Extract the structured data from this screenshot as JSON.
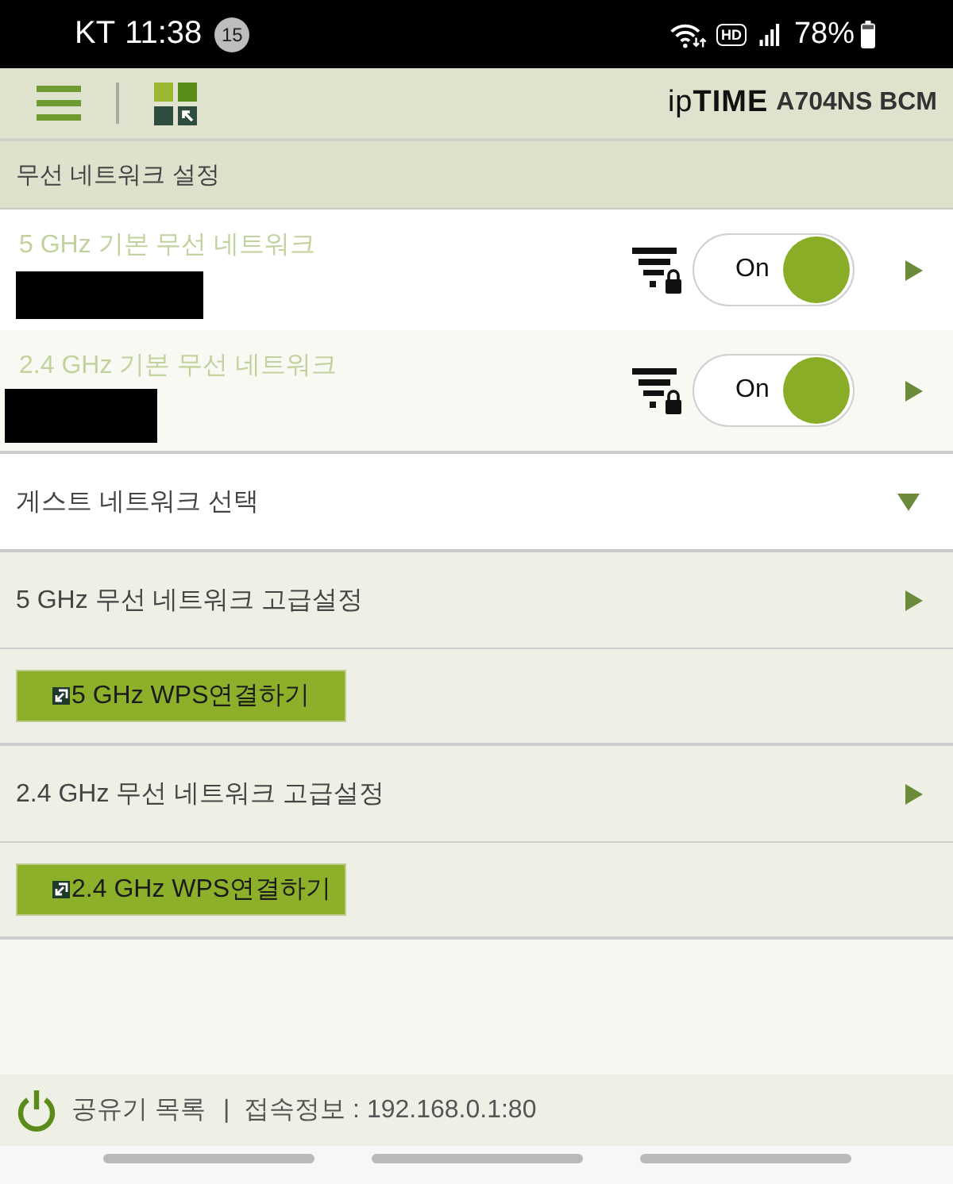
{
  "status_bar": {
    "carrier": "KT",
    "time": "11:38",
    "notification_count": "15",
    "hd_label": "HD",
    "battery": "78%"
  },
  "header": {
    "logo": "ip**TIME**",
    "model": "A704NS BCM"
  },
  "section_title": "무선 네트워크 설정",
  "networks": [
    {
      "title": "5 GHz 기본 무선 네트워크",
      "on": true,
      "switch_label": "On"
    },
    {
      "title": "2.4 GHz 기본 무선 네트워크",
      "on": true,
      "switch_label": "On"
    }
  ],
  "items": [
    {
      "kind": "dropdown",
      "label": "게스트 네트워크 선택",
      "expanded": false
    },
    {
      "kind": "link",
      "label": "5 GHz 무선 네트워크 고급설정"
    },
    {
      "kind": "button",
      "label": "5 GHz WPS연결하기"
    },
    {
      "kind": "link",
      "label": "2.4 GHz 무선 네트워크 고급설정"
    },
    {
      "kind": "button",
      "label": "2.4 GHz WPS연결하기"
    }
  ],
  "footer": {
    "router_list": "공유기 목록",
    "separator": "|",
    "connection_info": "접속정보 : 192.168.0.1:80"
  }
}
